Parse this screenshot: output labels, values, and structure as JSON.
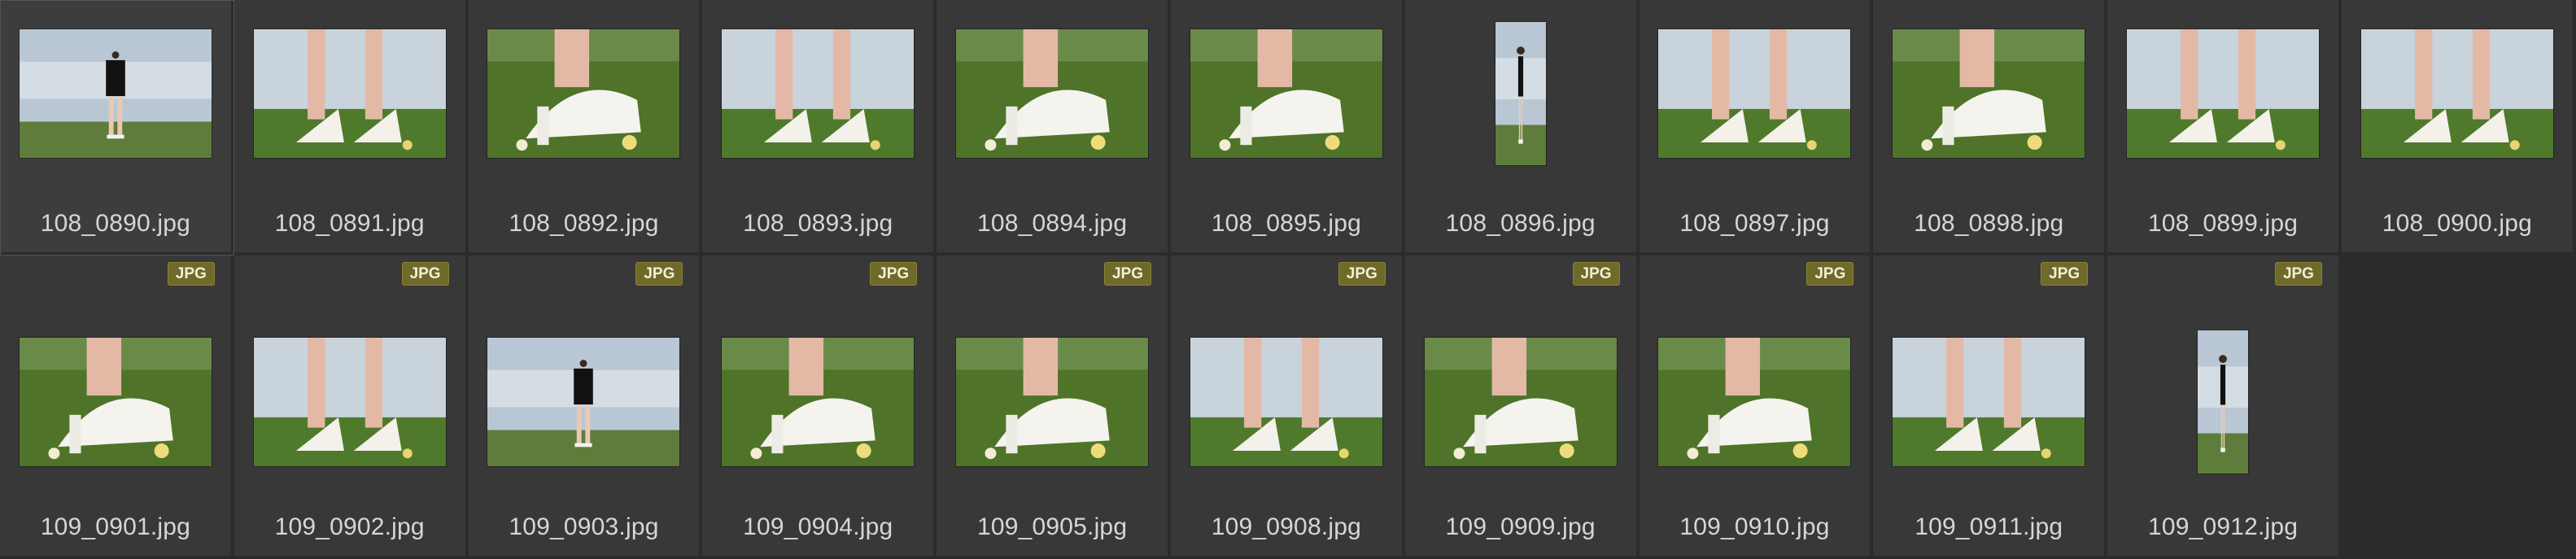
{
  "badge_label": "JPG",
  "colors": {
    "background": "#2f2f2f",
    "cell": "#383838",
    "filename_text": "#d6d6d6",
    "badge_bg": "#6f6a2a"
  },
  "files_row1": [
    {
      "name": "108_0890.jpg",
      "orientation": "land",
      "scene": "full-figure",
      "badge": false,
      "selected": true
    },
    {
      "name": "108_0891.jpg",
      "orientation": "land",
      "scene": "legs-sky",
      "badge": false
    },
    {
      "name": "108_0892.jpg",
      "orientation": "land",
      "scene": "shoe-grass",
      "badge": false
    },
    {
      "name": "108_0893.jpg",
      "orientation": "land",
      "scene": "legs-sky",
      "badge": false
    },
    {
      "name": "108_0894.jpg",
      "orientation": "land",
      "scene": "shoe-grass",
      "badge": false
    },
    {
      "name": "108_0895.jpg",
      "orientation": "land",
      "scene": "shoe-grass",
      "badge": false
    },
    {
      "name": "108_0896.jpg",
      "orientation": "port",
      "scene": "full-figure",
      "badge": false
    },
    {
      "name": "108_0897.jpg",
      "orientation": "land",
      "scene": "legs-sky",
      "badge": false
    },
    {
      "name": "108_0898.jpg",
      "orientation": "land",
      "scene": "shoe-grass",
      "badge": false
    },
    {
      "name": "108_0899.jpg",
      "orientation": "land",
      "scene": "legs-sky",
      "badge": false
    },
    {
      "name": "108_0900.jpg",
      "orientation": "land",
      "scene": "legs-sky",
      "badge": false
    }
  ],
  "files_row2": [
    {
      "name": "109_0901.jpg",
      "orientation": "land",
      "scene": "shoe-grass",
      "badge": true
    },
    {
      "name": "109_0902.jpg",
      "orientation": "land",
      "scene": "legs-sky",
      "badge": true
    },
    {
      "name": "109_0903.jpg",
      "orientation": "land",
      "scene": "full-figure",
      "badge": true
    },
    {
      "name": "109_0904.jpg",
      "orientation": "land",
      "scene": "shoe-grass",
      "badge": true
    },
    {
      "name": "109_0905.jpg",
      "orientation": "land",
      "scene": "shoe-grass",
      "badge": true
    },
    {
      "name": "109_0908.jpg",
      "orientation": "land",
      "scene": "legs-sky",
      "badge": true
    },
    {
      "name": "109_0909.jpg",
      "orientation": "land",
      "scene": "shoe-grass",
      "badge": true
    },
    {
      "name": "109_0910.jpg",
      "orientation": "land",
      "scene": "shoe-grass",
      "badge": true
    },
    {
      "name": "109_0911.jpg",
      "orientation": "land",
      "scene": "legs-sky",
      "badge": true
    },
    {
      "name": "109_0912.jpg",
      "orientation": "port",
      "scene": "full-figure",
      "badge": true
    }
  ]
}
